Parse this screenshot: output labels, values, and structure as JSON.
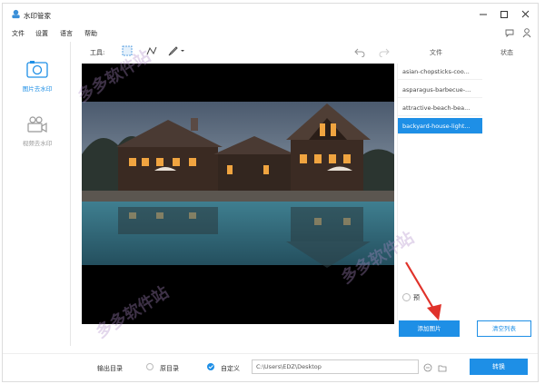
{
  "window": {
    "title": "水印管家"
  },
  "menu": [
    "文件",
    "设置",
    "语言",
    "帮助"
  ],
  "sidebar": {
    "items": [
      {
        "label": "图片去水印",
        "icon": "image-icon",
        "active": true
      },
      {
        "label": "视频去水印",
        "icon": "video-camera-icon",
        "active": false
      }
    ]
  },
  "toolbar": {
    "label": "工具:",
    "tools": [
      "rectangle-select-icon",
      "polyline-icon",
      "brush-icon"
    ]
  },
  "file_list": {
    "columns": [
      "文件",
      "状态"
    ],
    "files": [
      {
        "name": "asian-chopsticks-coo...",
        "selected": false
      },
      {
        "name": "asparagus-barbecue-...",
        "selected": false
      },
      {
        "name": "attractive-beach-bea...",
        "selected": false
      },
      {
        "name": "backyard-house-light...",
        "selected": true
      }
    ],
    "preview_label": "预",
    "add_button": "添加图片",
    "clear_button": "清空列表"
  },
  "output": {
    "label": "输出目录",
    "option_original": "原目录",
    "option_custom": "自定义",
    "selected": "自定义",
    "path": "C:\\Users\\EDZ\\Desktop",
    "convert_button": "转换"
  },
  "colors": {
    "accent": "#1e8fe6",
    "arrow": "#e0322a"
  }
}
